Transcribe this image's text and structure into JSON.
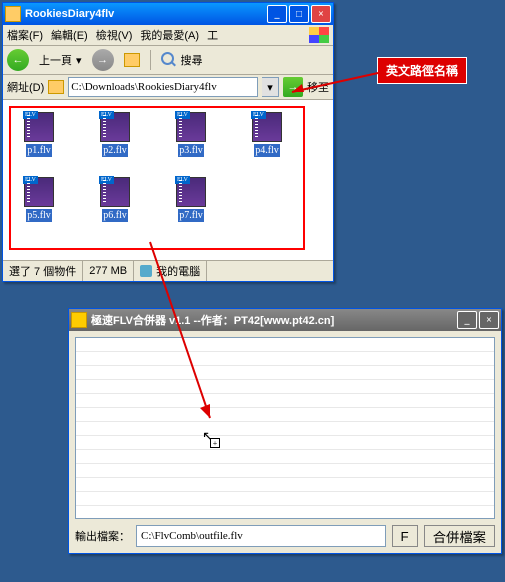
{
  "win1": {
    "title": "RookiesDiary4flv",
    "menu": [
      "檔案(F)",
      "編輯(E)",
      "檢視(V)",
      "我的最愛(A)",
      "工"
    ],
    "back": "上一頁",
    "search": "搜尋",
    "addrlabel": "網址(D)",
    "path": "C:\\Downloads\\RookiesDiary4flv",
    "go": "移至",
    "files": [
      "p1.flv",
      "p2.flv",
      "p3.flv",
      "p4.flv",
      "p5.flv",
      "p6.flv",
      "p7.flv"
    ],
    "status": {
      "sel": "選了 7 個物件",
      "size": "277 MB",
      "loc": "我的電腦"
    }
  },
  "win2": {
    "title": "極速FLV合併器 v1.1 --作者：PT42[www.pt42.cn]",
    "outlabel": "輸出檔案：",
    "outpath": "C:\\FlvComb\\outfile.flv",
    "fbtn": "F",
    "merge": "合併檔案"
  },
  "callout": "英文路徑名稱"
}
